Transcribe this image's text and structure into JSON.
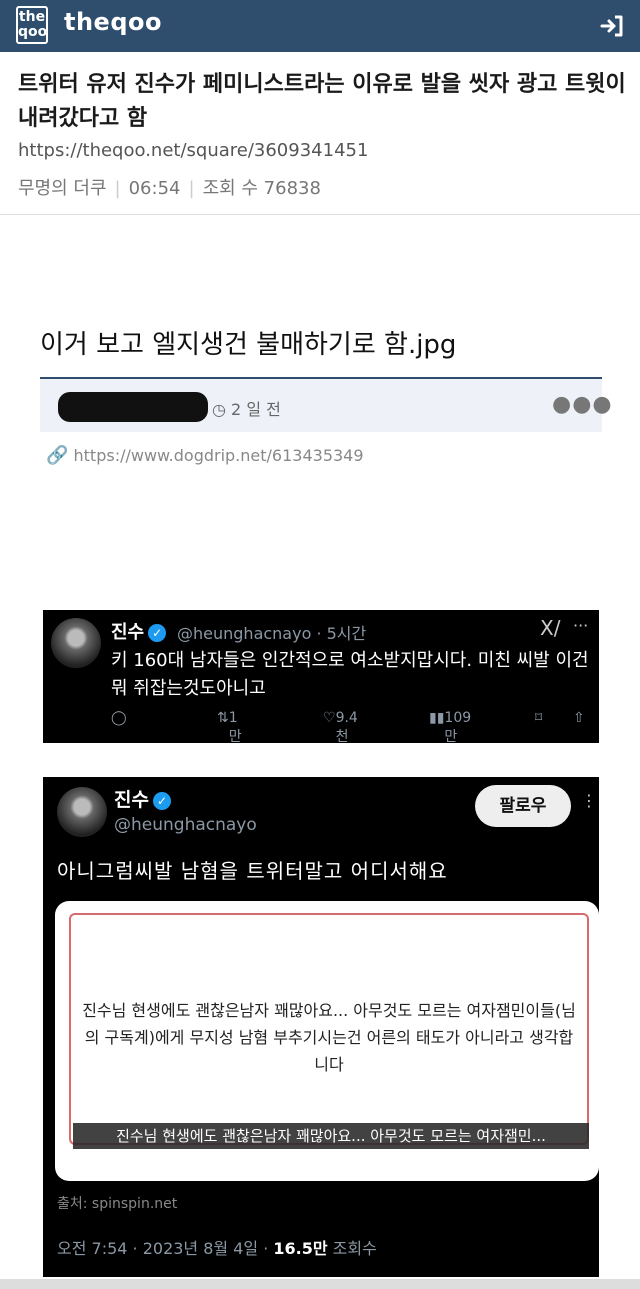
{
  "header": {
    "logo_text": "the qoo",
    "site_name": "theqoo",
    "login_icon": "login-arrow-icon",
    "brand_color": "#2f4e6d"
  },
  "post": {
    "title": "트위터 유저 진수가 페미니스트라는 이유로 발을 씻자 광고 트윗이 내려갔다고 함",
    "url": "https://theqoo.net/square/3609341451",
    "author": "무명의 더쿠",
    "time": "06:54",
    "views": "조회 수 76838"
  },
  "content": {
    "title": "이거 보고 엘지생건 불매하기로 함.jpg",
    "time_ago": "2 일 전",
    "link": "https://www.dogdrip.net/613435349"
  },
  "tweet1": {
    "name": "진수",
    "handle": "@heunghacnayo · 5시간",
    "text": "키 160대 남자들은 인간적으로 여소받지맙시다. 미친 씨발 이건 뭐 쥐잡는것도아니고",
    "retweets": "1만",
    "likes": "9.4천",
    "views": "109만"
  },
  "tweet2": {
    "name": "진수",
    "handle": "@heunghacnayo",
    "follow_label": "팔로우",
    "text": "아니그럼씨발 남혐을 트위터말고 어디서해요",
    "image_text": "진수님 현생에도 괜찮은남자 꽤많아요... 아무것도 모르는 여자잼민이들(님의 구독계)에게 무지성 남혐 부추기시는건 어른의 태도가 아니라고 생각합니다",
    "image_caption": "진수님 현생에도 괜찮은남자 꽤많아요... 아무것도 모르는 여자잼민...",
    "source": "출처: spinspin.net",
    "date": "오전 7:54 · 2023년 8월 4일 · ",
    "view_count": "16.5만",
    "view_label": " 조회수"
  }
}
